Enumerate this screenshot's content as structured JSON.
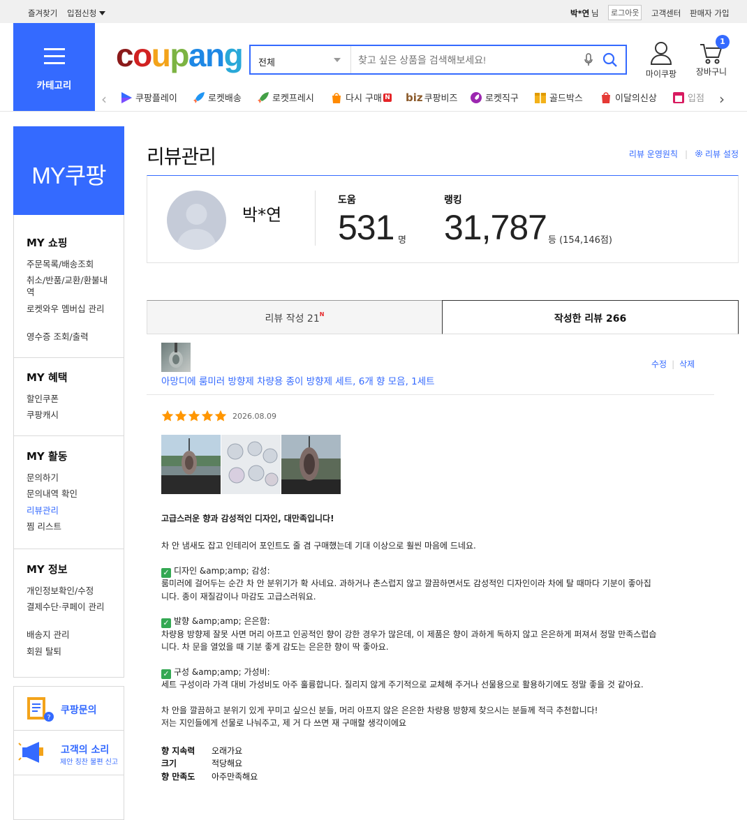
{
  "topbar": {
    "bookmark": "즐겨찾기",
    "apply": "입점신청",
    "user_name": "박*연",
    "user_suffix": "님",
    "logout": "로그아웃",
    "customer_center": "고객센터",
    "seller_join": "판매자 가입"
  },
  "header": {
    "category_label": "카테고리",
    "logo": [
      "c",
      "o",
      "u",
      "p",
      "a",
      "n",
      "g"
    ],
    "search_scope": "전체",
    "search_placeholder": "찾고 싶은 상품을 검색해보세요!",
    "my_coupang": "마이쿠팡",
    "cart": "장바구니",
    "cart_count": "1"
  },
  "quick_links": [
    {
      "label": "쿠팡플레이",
      "icon": "play-icon",
      "color": "#346aff"
    },
    {
      "label": "로켓배송",
      "icon": "rocket-icon",
      "color": "#2196f3"
    },
    {
      "label": "로켓프레시",
      "icon": "rocket-fresh-icon",
      "color": "#43a047"
    },
    {
      "label": "다시 구매",
      "icon": "repurchase-icon",
      "color": "#ff8a00",
      "badge": "N"
    },
    {
      "label": "쿠팡비즈",
      "icon": "biz-icon",
      "color": "#8b5a2b",
      "prefix": "biz"
    },
    {
      "label": "로켓직구",
      "icon": "rocket-direct-icon",
      "color": "#9c27b0"
    },
    {
      "label": "골드박스",
      "icon": "goldbox-icon",
      "color": "#f3b11a"
    },
    {
      "label": "이달의신상",
      "icon": "new-icon",
      "color": "#e53935"
    },
    {
      "label": "입점",
      "icon": "store-icon",
      "color": "#d81b60"
    }
  ],
  "sidebar": {
    "title": "MY쿠팡",
    "sections": [
      {
        "title": "MY 쇼핑",
        "items": [
          "주문목록/배송조회",
          "취소/반품/교환/환불내역",
          "로켓와우 멤버십 관리",
          "영수증 조회/출력"
        ]
      },
      {
        "title": "MY 혜택",
        "items": [
          "할인쿠폰",
          "쿠팡캐시"
        ]
      },
      {
        "title": "MY 활동",
        "items": [
          "문의하기",
          "문의내역 확인",
          "리뷰관리",
          "찜 리스트"
        ]
      },
      {
        "title": "MY 정보",
        "items": [
          "개인정보확인/수정",
          "결제수단·쿠페이 관리",
          "배송지 관리",
          "회원 탈퇴"
        ]
      }
    ],
    "active_item": "리뷰관리",
    "cs_inquiry": "쿠팡문의",
    "voice_title": "고객의 소리",
    "voice_sub": "제안 칭찬 불편 신고"
  },
  "main": {
    "title": "리뷰관리",
    "policy_link": "리뷰 운영원칙",
    "settings_link": "리뷰 설정",
    "profile": {
      "name": "박*연",
      "help_label": "도움",
      "help_count": "531",
      "help_unit": "명",
      "rank_label": "랭킹",
      "rank": "31,787",
      "rank_unit": "등 (154,146점)"
    },
    "tabs": {
      "write_label": "리뷰 작성 21",
      "write_badge": "N",
      "written_label": "작성한 리뷰 266"
    },
    "review": {
      "product_name": "아망디에 룸미러 방향제 차량용 종이 방향제 세트, 6개 향 모음, 1세트",
      "edit": "수정",
      "delete": "삭제",
      "rating": 5,
      "date": "2026.08.09",
      "headline": "고급스러운 향과 감성적인 디자인, 대만족입니다!",
      "intro": "차 안 냄새도 잡고 인테리어 포인트도 줄 겸 구매했는데 기대 이상으로 훨씬 마음에 드네요.",
      "p1_title": "디자인 &amp;amp; 감성:",
      "p1_line1": "룸미러에 걸어두는 순간 차 안 분위기가 확 사네요. 과하거나 촌스럽지 않고 깔끔하면서도 감성적인 디자인이라 차에 탈 때마다 기분이 좋아집",
      "p1_line2": "니다. 종이 재질감이나 마감도 고급스러워요.",
      "p2_title": "발향 &amp;amp; 은은함:",
      "p2_line1": "차량용 방향제 잘못 사면 머리 아프고 인공적인 향이 강한 경우가 많은데, 이 제품은 향이 과하게 독하지 않고 은은하게 퍼져서 정말 만족스럽습",
      "p2_line2": "니다. 차 문을 열었을 때 기분 좋게 감도는 은은한 향이 딱 좋아요.",
      "p3_title": "구성 &amp;amp; 가성비:",
      "p3_line1": "세트 구성이라 가격 대비 가성비도 아주 훌륭합니다. 질리지 않게 주기적으로 교체해 주거나 선물용으로 활용하기에도 정말 좋을 것 같아요.",
      "outro1": "차 안을 깔끔하고 분위기 있게 꾸미고 싶으신 분들, 머리 아프지 않은 은은한 차량용 방향제 찾으시는 분들께 적극 추천합니다!",
      "outro2": "저는 지인들에게 선물로 나눠주고, 제 거 다 쓰면 재 구매할 생각이에요",
      "survey": [
        {
          "k": "향 지속력",
          "v": "오래가요"
        },
        {
          "k": "크기",
          "v": "적당해요"
        },
        {
          "k": "향 만족도",
          "v": "아주만족해요"
        }
      ]
    }
  },
  "colors": {
    "accent": "#346aff",
    "star": "#ff9600",
    "badge_red": "#e52528"
  }
}
